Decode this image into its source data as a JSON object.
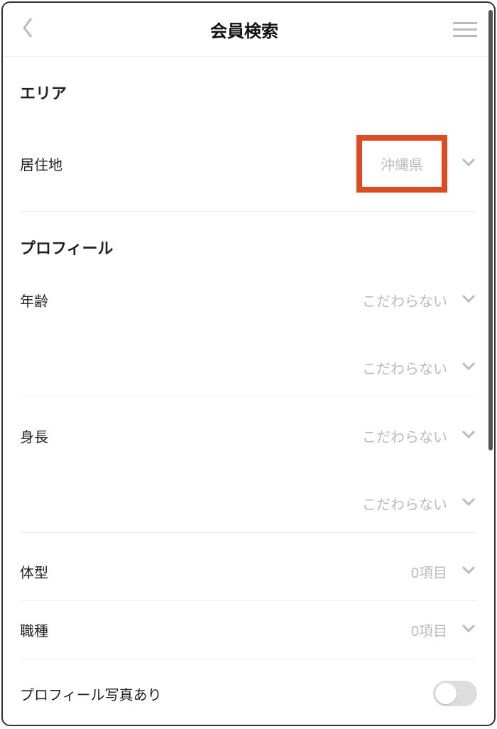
{
  "header": {
    "title": "会員検索"
  },
  "sections": {
    "area": {
      "title": "エリア",
      "residence": {
        "label": "居住地",
        "value": "沖縄県"
      }
    },
    "profile": {
      "title": "プロフィール",
      "age": {
        "label": "年齢",
        "value1": "こだわらない",
        "value2": "こだわらない"
      },
      "height": {
        "label": "身長",
        "value1": "こだわらない",
        "value2": "こだわらない"
      },
      "body": {
        "label": "体型",
        "value": "0項目"
      },
      "occupation": {
        "label": "職種",
        "value": "0項目"
      },
      "photo": {
        "label": "プロフィール写真あり"
      }
    }
  },
  "colors": {
    "highlight": "#e04a1e",
    "text_muted": "#bbb"
  }
}
